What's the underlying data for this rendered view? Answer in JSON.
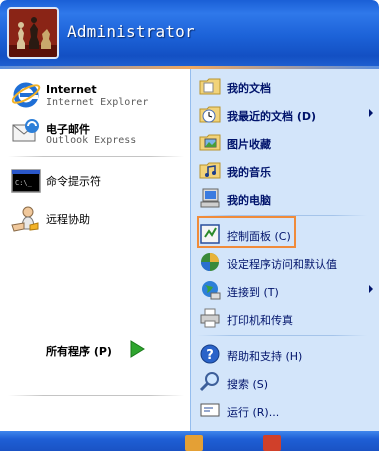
{
  "header": {
    "user_name": "Administrator"
  },
  "pinned": [
    {
      "title": "Internet",
      "subtitle": "Internet Explorer",
      "icon": "internet-explorer-icon"
    },
    {
      "title": "电子邮件",
      "subtitle": "Outlook Express",
      "icon": "outlook-express-icon"
    }
  ],
  "recent": [
    {
      "label": "命令提示符",
      "icon": "command-prompt-icon"
    },
    {
      "label": "远程协助",
      "icon": "remote-assistance-icon"
    }
  ],
  "all_programs": {
    "label": "所有程序 (P)"
  },
  "right_items": {
    "my_documents": "我的文档",
    "recent_documents": "我最近的文档 (D)",
    "my_pictures": "图片收藏",
    "my_music": "我的音乐",
    "my_computer": "我的电脑",
    "control_panel": "控制面板 (C)",
    "program_access": "设定程序访问和默认值",
    "connect_to": "连接到 (T)",
    "printers": "打印机和传真",
    "help": "帮助和支持 (H)",
    "search": "搜索 (S)",
    "run": "运行 (R)..."
  },
  "colors": {
    "header_blue": "#1c62d8",
    "right_pane": "#d3e5fa",
    "highlight": "#f08b3a"
  }
}
